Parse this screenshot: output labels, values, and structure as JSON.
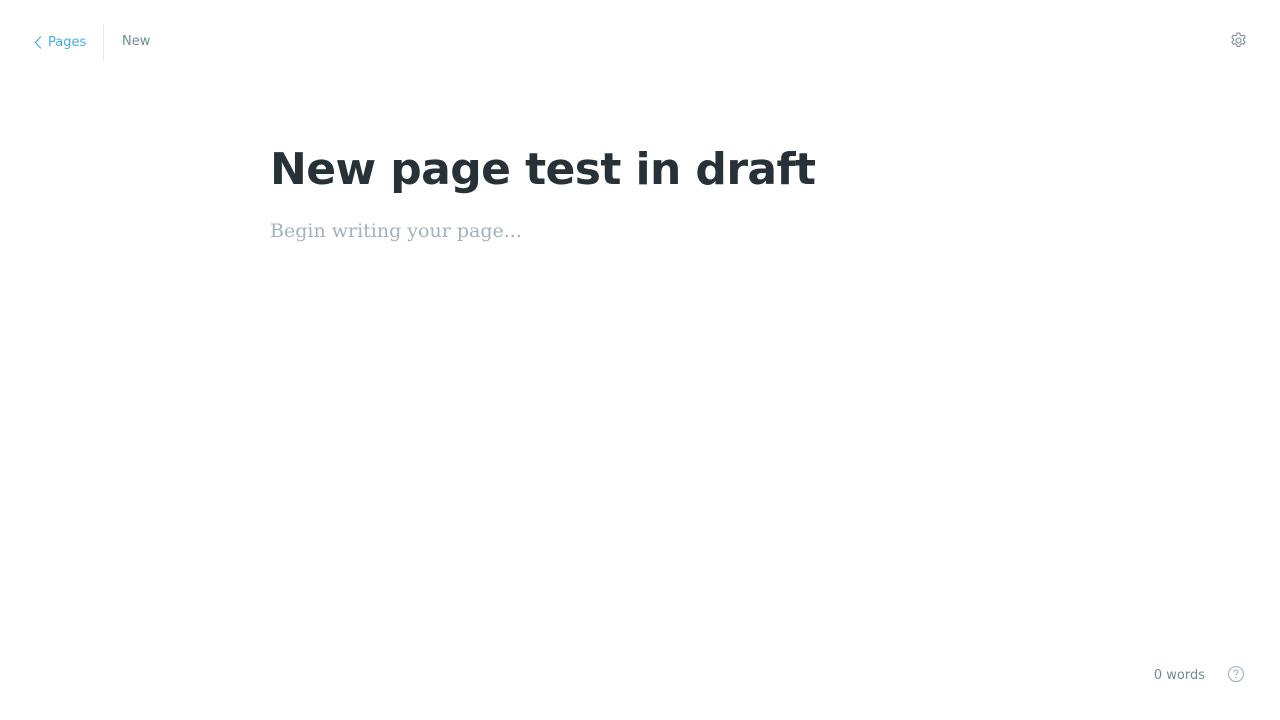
{
  "header": {
    "back_label": "Pages",
    "status_label": "New",
    "settings_icon": "gear-icon",
    "back_icon": "chevron-left-icon"
  },
  "editor": {
    "title": "New page test in draft",
    "body_placeholder": "Begin writing your page..."
  },
  "footer": {
    "word_count": "0 words",
    "help_icon": "question-circle-icon"
  },
  "colors": {
    "accent": "#3eb0ef",
    "title": "#263238",
    "muted": "#738a94",
    "placeholder": "#a3b1ba"
  }
}
